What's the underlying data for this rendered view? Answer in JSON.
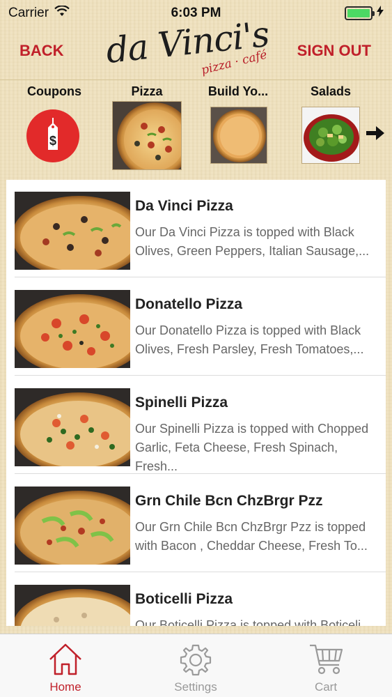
{
  "status_bar": {
    "carrier": "Carrier",
    "time": "6:03 PM",
    "battery_level": 1.0
  },
  "header": {
    "back_label": "BACK",
    "signout_label": "SIGN OUT",
    "logo_main": "da Vinci's",
    "logo_sub": "pizza · café"
  },
  "categories": [
    {
      "label": "Coupons",
      "icon": "price-tag-dollar-icon"
    },
    {
      "label": "Pizza",
      "icon": "pizza-thumbnail",
      "selected": true
    },
    {
      "label": "Build Yo...",
      "icon": "cheese-pizza-thumbnail"
    },
    {
      "label": "Salads",
      "icon": "salad-thumbnail"
    }
  ],
  "menu_items": [
    {
      "title": "Da Vinci Pizza",
      "description": "Our Da Vinci Pizza is topped with Black Olives, Green Peppers, Italian Sausage,..."
    },
    {
      "title": "Donatello Pizza",
      "description": "Our Donatello Pizza is topped with Black Olives, Fresh Parsley, Fresh Tomatoes,..."
    },
    {
      "title": "Spinelli Pizza",
      "description": "Our Spinelli Pizza is topped with Chopped Garlic, Feta Cheese, Fresh Spinach, Fresh..."
    },
    {
      "title": "Grn Chile Bcn ChzBrgr Pzz",
      "description": "Our Grn Chile Bcn ChzBrgr Pzz is topped with Bacon , Cheddar Cheese, Fresh To..."
    },
    {
      "title": "Boticelli Pizza",
      "description": "Our Boticelli Pizza is topped with Boticeli"
    }
  ],
  "tabs": [
    {
      "label": "Home",
      "icon": "home-icon",
      "active": true
    },
    {
      "label": "Settings",
      "icon": "gear-icon"
    },
    {
      "label": "Cart",
      "icon": "cart-icon"
    }
  ],
  "colors": {
    "accent": "#c0202a",
    "coupon_red": "#e22a2a",
    "battery_green": "#4cd964"
  }
}
